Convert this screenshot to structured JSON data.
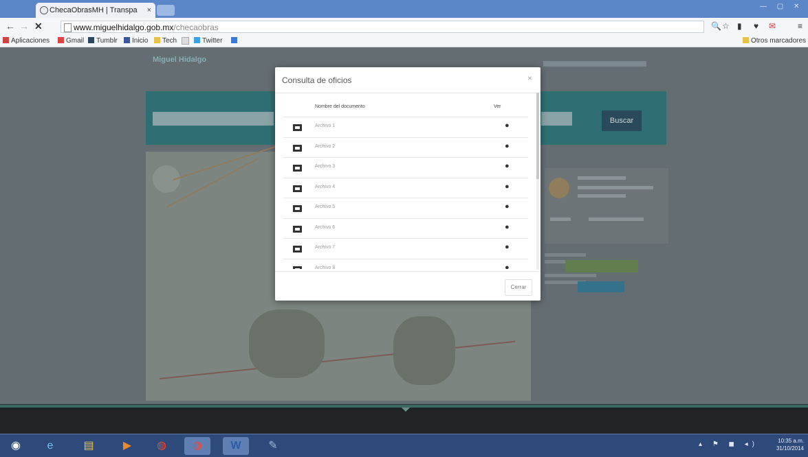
{
  "browser": {
    "tab_title": "ChecaObrasMH | Transpa",
    "tab_close": "×",
    "url_host": "www.miguelhidalgo.gob.mx",
    "url_path": "/checaobras",
    "bookmarks": [
      "Aplicaciones",
      "Gmail",
      "Tumblr",
      "Inicio",
      "Tech",
      "Twitter"
    ],
    "other_bookmarks": "Otros marcadores"
  },
  "page": {
    "search_button": "Buscar",
    "logo_text": "Miguel Hidalgo"
  },
  "modal": {
    "title": "Consulta de oficios",
    "close": "×",
    "col_name": "Nombre del documento",
    "col_view": "Ver",
    "rows": [
      "Archivo 1",
      "Archivo 2",
      "Archivo 3",
      "Archivo 4",
      "Archivo 5",
      "Archivo 6",
      "Archivo 7",
      "Archivo 8"
    ],
    "close_button": "Cerrar"
  },
  "taskbar": {
    "time": "10:35 a.m.",
    "date": "31/10/2014"
  },
  "icons": {
    "row_icon": "image-icon",
    "view_icon": "eye-icon"
  }
}
